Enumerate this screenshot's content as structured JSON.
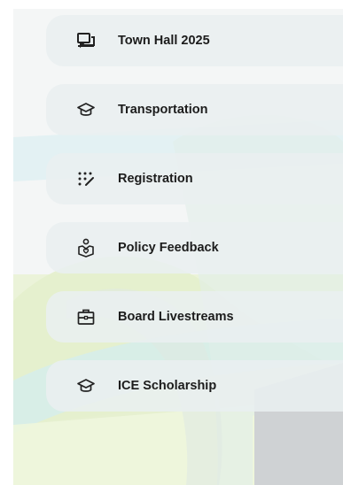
{
  "menu": {
    "items": [
      {
        "label": "Town Hall 2025",
        "icon": "chat-bubbles-icon"
      },
      {
        "label": "Transportation",
        "icon": "graduation-cap-icon"
      },
      {
        "label": "Registration",
        "icon": "dotted-edit-icon"
      },
      {
        "label": "Policy Feedback",
        "icon": "person-heart-icon"
      },
      {
        "label": "Board Livestreams",
        "icon": "briefcase-icon"
      },
      {
        "label": "ICE Scholarship",
        "icon": "graduation-cap-icon"
      }
    ]
  },
  "colors": {
    "item_background": "#e9eff0",
    "text": "#1c1c1c",
    "background_gray": "#cfd2d4",
    "background_green": "#e3efc8",
    "background_teal": "#d2ecec"
  }
}
